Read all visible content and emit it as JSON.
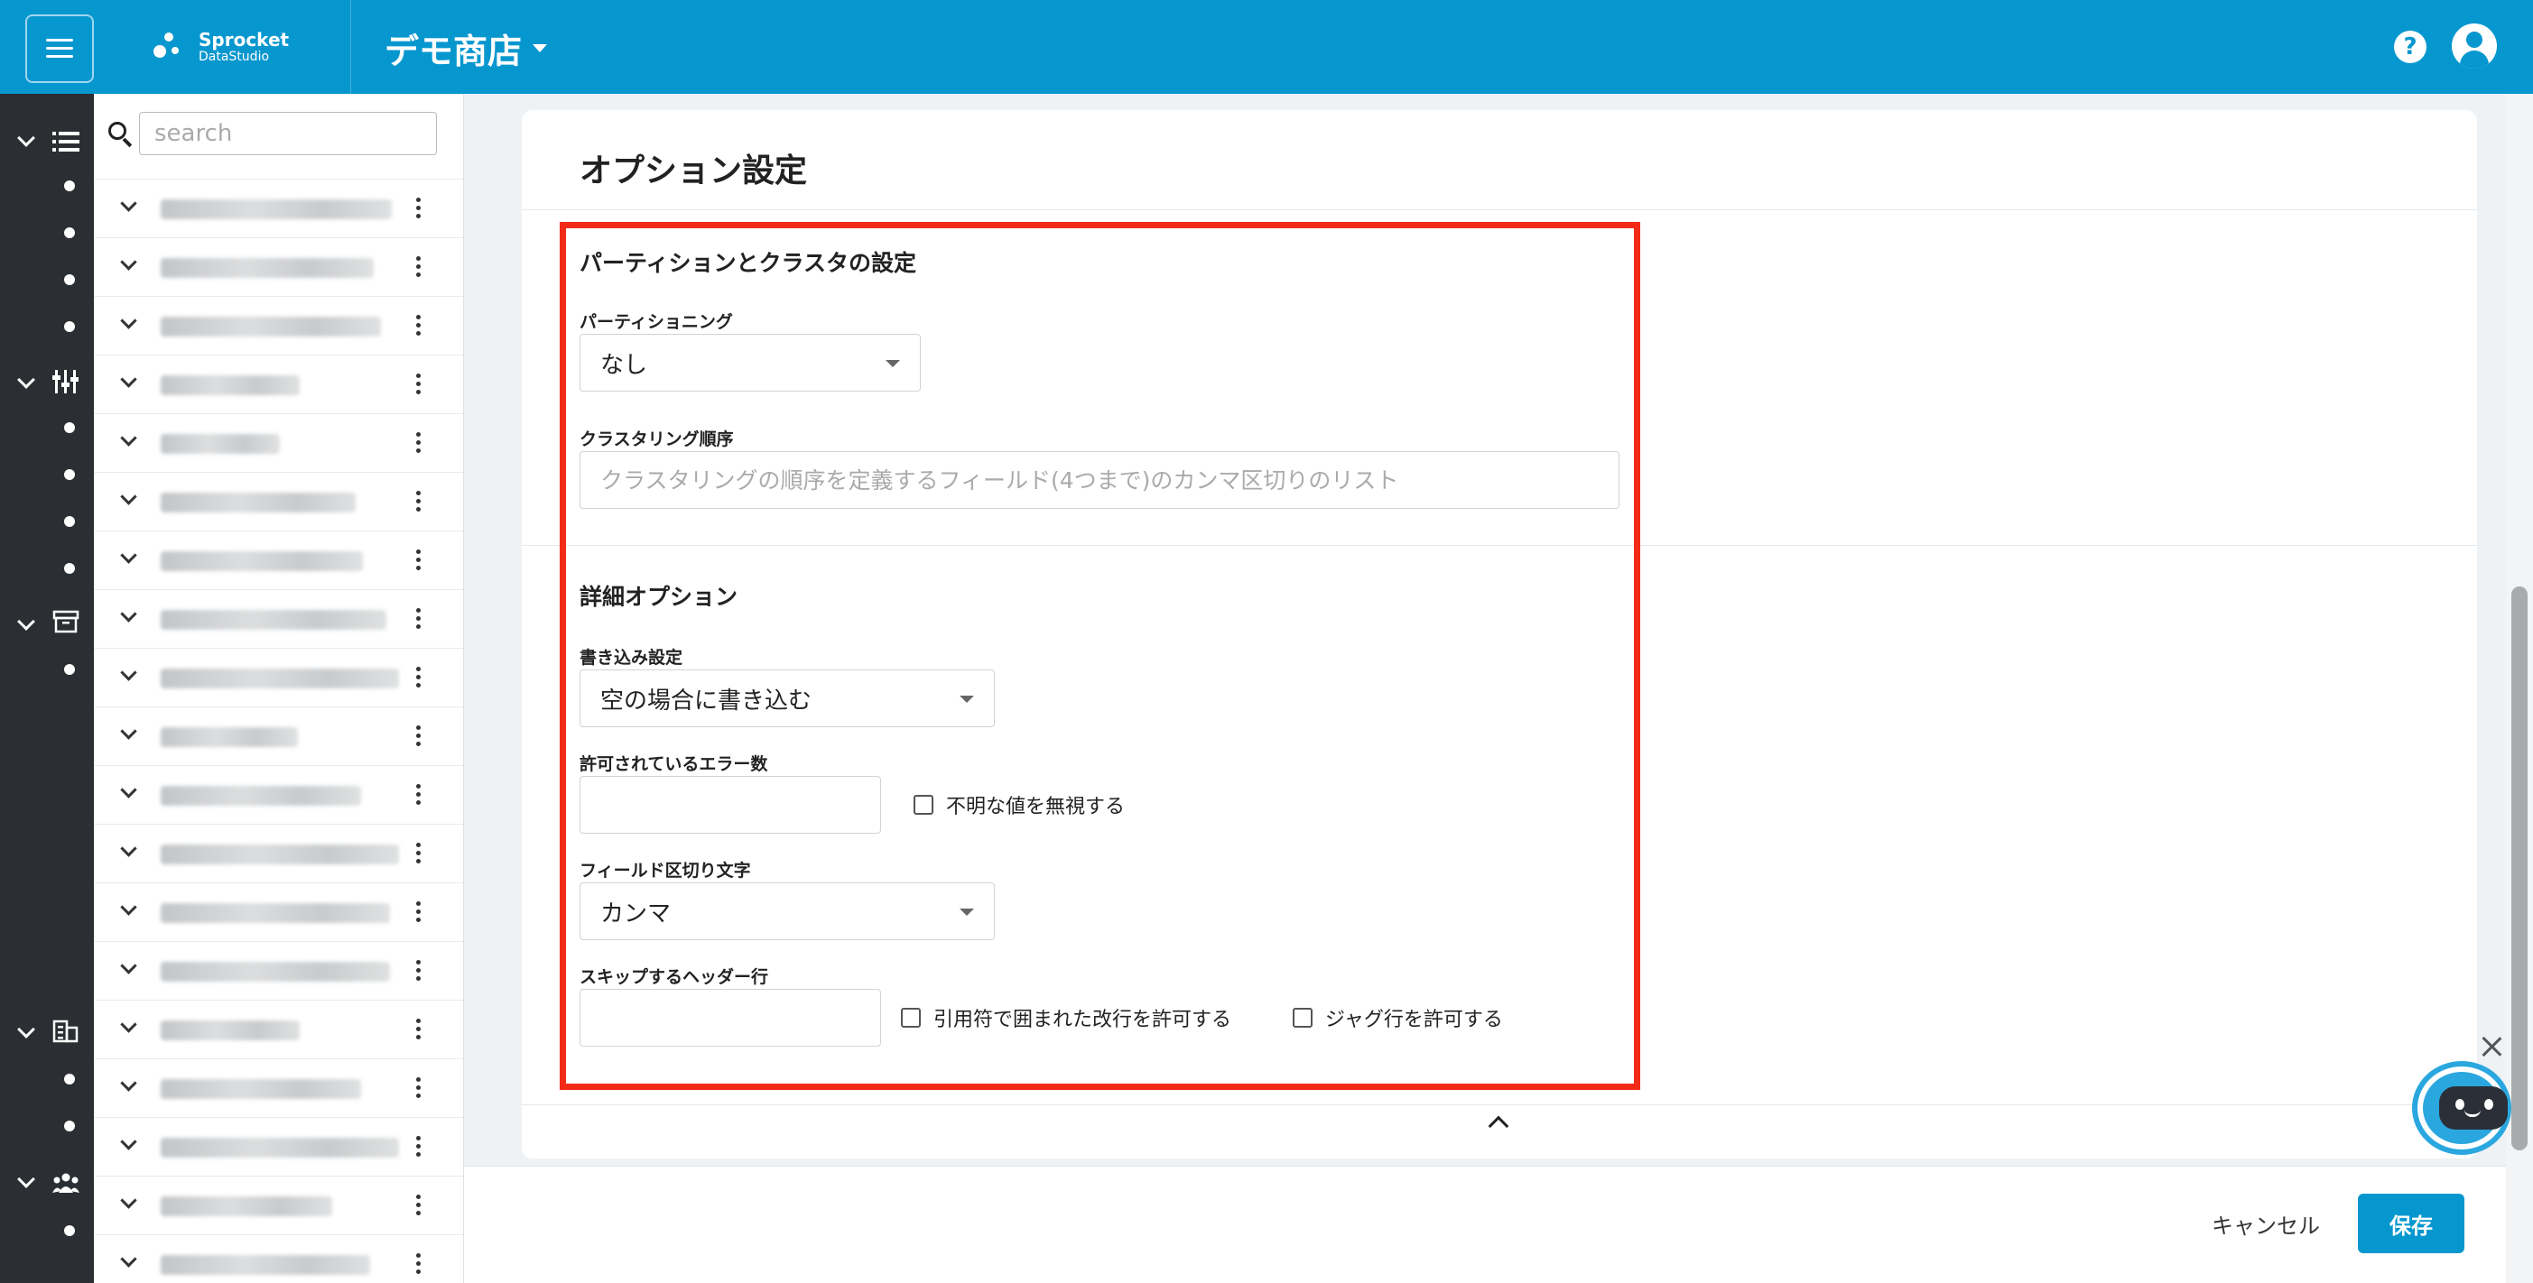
{
  "header": {
    "logo_line1": "Sprocket",
    "logo_line2": "DataStudio",
    "store_name": "デモ商店",
    "help_icon": "help-circle-icon",
    "user_icon": "account-circle-icon",
    "menu_icon": "hamburger-menu-icon",
    "brand_color": "#0797cf"
  },
  "tree": {
    "search_placeholder": "search"
  },
  "card": {
    "title": "オプション設定",
    "partition_section": {
      "title": "パーティションとクラスタの設定",
      "partitioning_label": "パーティショニング",
      "partitioning_value": "なし",
      "clustering_label": "クラスタリング順序",
      "clustering_placeholder": "クラスタリングの順序を定義するフィールド(4つまで)のカンマ区切りのリスト"
    },
    "advanced_section": {
      "title": "詳細オプション",
      "write_label": "書き込み設定",
      "write_value": "空の場合に書き込む",
      "errors_label": "許可されているエラー数",
      "errors_value": "",
      "ignore_unknown_label": "不明な値を無視する",
      "delimiter_label": "フィールド区切り文字",
      "delimiter_value": "カンマ",
      "skip_header_label": "スキップするヘッダー行",
      "skip_header_value": "",
      "allow_quoted_newlines_label": "引用符で囲まれた改行を許可する",
      "allow_jagged_rows_label": "ジャグ行を許可する"
    },
    "highlight_color": "#f22b17"
  },
  "footer": {
    "cancel_label": "キャンセル",
    "save_label": "保存"
  }
}
